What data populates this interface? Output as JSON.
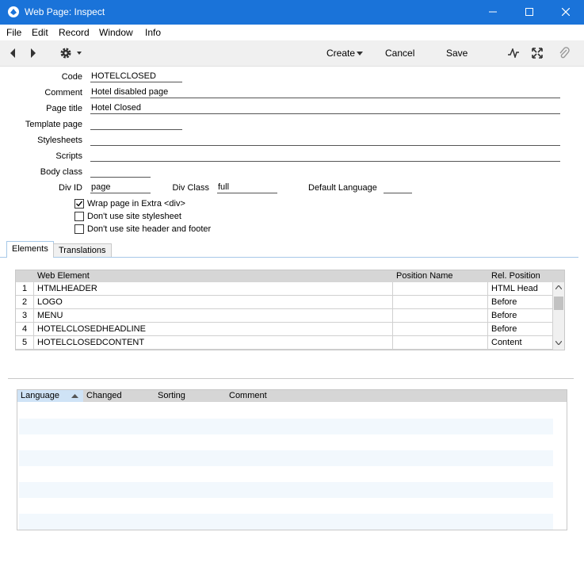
{
  "window": {
    "title": "Web Page: Inspect"
  },
  "menu": [
    "File",
    "Edit",
    "Record",
    "Window",
    "Info"
  ],
  "toolbar": {
    "create": "Create",
    "cancel": "Cancel",
    "save": "Save"
  },
  "form": {
    "code_label": "Code",
    "code": "HOTELCLOSED",
    "comment_label": "Comment",
    "comment": "Hotel disabled page",
    "page_title_label": "Page title",
    "page_title": "Hotel Closed",
    "template_label": "Template page",
    "template": "",
    "stylesheets_label": "Stylesheets",
    "stylesheets": "",
    "scripts_label": "Scripts",
    "scripts": "",
    "body_class_label": "Body class",
    "body_class": "",
    "div_id_label": "Div ID",
    "div_id": "page",
    "div_class_label": "Div Class",
    "div_class": "full",
    "default_lang_label": "Default Language",
    "default_lang": "",
    "wrap_label": "Wrap page in Extra <div>",
    "no_stylesheet_label": "Don't use site stylesheet",
    "no_header_label": "Don't use site header and footer"
  },
  "tabs": [
    "Elements",
    "Translations"
  ],
  "elements_grid": {
    "headers": [
      "Web Element",
      "Position Name",
      "Rel. Position"
    ],
    "rows": [
      {
        "n": "1",
        "element": "HTMLHEADER",
        "pos_name": "",
        "rel": "HTML Head"
      },
      {
        "n": "2",
        "element": "LOGO",
        "pos_name": "",
        "rel": "Before"
      },
      {
        "n": "3",
        "element": "MENU",
        "pos_name": "",
        "rel": "Before"
      },
      {
        "n": "4",
        "element": "HOTELCLOSEDHEADLINE",
        "pos_name": "",
        "rel": "Before"
      },
      {
        "n": "5",
        "element": "HOTELCLOSEDCONTENT",
        "pos_name": "",
        "rel": "Content"
      }
    ]
  },
  "lang_grid": {
    "headers": [
      "Language",
      "Changed",
      "Sorting",
      "Comment"
    ]
  }
}
